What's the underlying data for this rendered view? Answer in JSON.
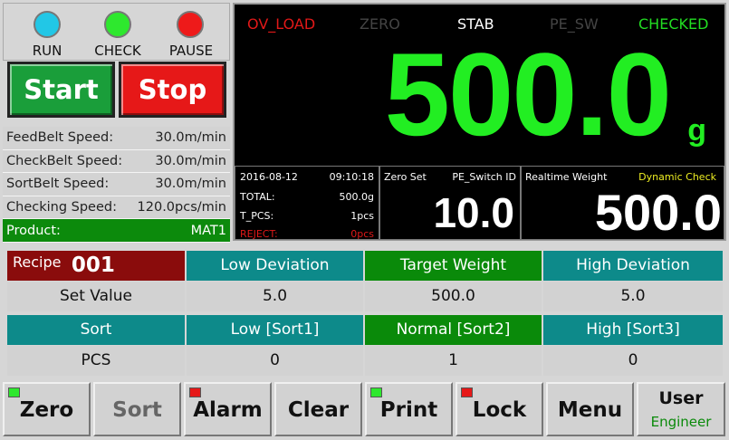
{
  "lamps": [
    {
      "label": "RUN",
      "color": "#22c7e6"
    },
    {
      "label": "CHECK",
      "color": "#2ee82e"
    },
    {
      "label": "PAUSE",
      "color": "#ee1a1a"
    }
  ],
  "buttons": {
    "start": "Start",
    "stop": "Stop",
    "start_color": "#1a9e3a",
    "stop_color": "#e61818"
  },
  "speeds": [
    {
      "label": "FeedBelt Speed:",
      "value": "30.0m/min"
    },
    {
      "label": "CheckBelt Speed:",
      "value": "30.0m/min"
    },
    {
      "label": "SortBelt Speed:",
      "value": "30.0m/min"
    },
    {
      "label": "Checking Speed:",
      "value": "120.0pcs/min"
    }
  ],
  "product": {
    "label": "Product:",
    "value": "MAT1"
  },
  "status": [
    {
      "label": "OV_LOAD",
      "color": "#e01818"
    },
    {
      "label": "ZERO",
      "color": "#444444"
    },
    {
      "label": "STAB",
      "color": "#ffffff"
    },
    {
      "label": "PE_SW",
      "color": "#444444"
    },
    {
      "label": "CHECKED",
      "color": "#22dd22"
    }
  ],
  "weight": {
    "value": "500.0",
    "unit": "g"
  },
  "info": {
    "date": "2016-08-12",
    "time": "09:10:18",
    "total_label": "TOTAL:",
    "total_value": "500.0g",
    "tpcs_label": "T_PCS:",
    "tpcs_value": "1pcs",
    "reject_label": "REJECT:",
    "reject_value": "0pcs"
  },
  "zero_set": {
    "label": "Zero Set",
    "pe_label": "PE_Switch ID",
    "value": "10.0"
  },
  "realtime": {
    "label": "Realtime Weight",
    "dyn_label": "Dynamic Check",
    "value": "500.0"
  },
  "recipe": {
    "label": "Recipe",
    "number": "001"
  },
  "table1": {
    "headers": [
      "Low Deviation",
      "Target Weight",
      "High Deviation"
    ],
    "row_label": "Set Value",
    "values": [
      "5.0",
      "500.0",
      "5.0"
    ]
  },
  "table2": {
    "corner": "Sort",
    "headers": [
      "Low [Sort1]",
      "Normal [Sort2]",
      "High [Sort3]"
    ],
    "row_label": "PCS",
    "values": [
      "0",
      "1",
      "0"
    ]
  },
  "footer": [
    {
      "label": "Zero",
      "indicator": "#2ee82e"
    },
    {
      "label": "Sort",
      "indicator": ""
    },
    {
      "label": "Alarm",
      "indicator": "#e61818"
    },
    {
      "label": "Clear",
      "indicator": ""
    },
    {
      "label": "Print",
      "indicator": "#2ee82e"
    },
    {
      "label": "Lock",
      "indicator": "#e61818"
    },
    {
      "label": "Menu",
      "indicator": ""
    }
  ],
  "user": {
    "label": "User",
    "role": "Engineer"
  }
}
